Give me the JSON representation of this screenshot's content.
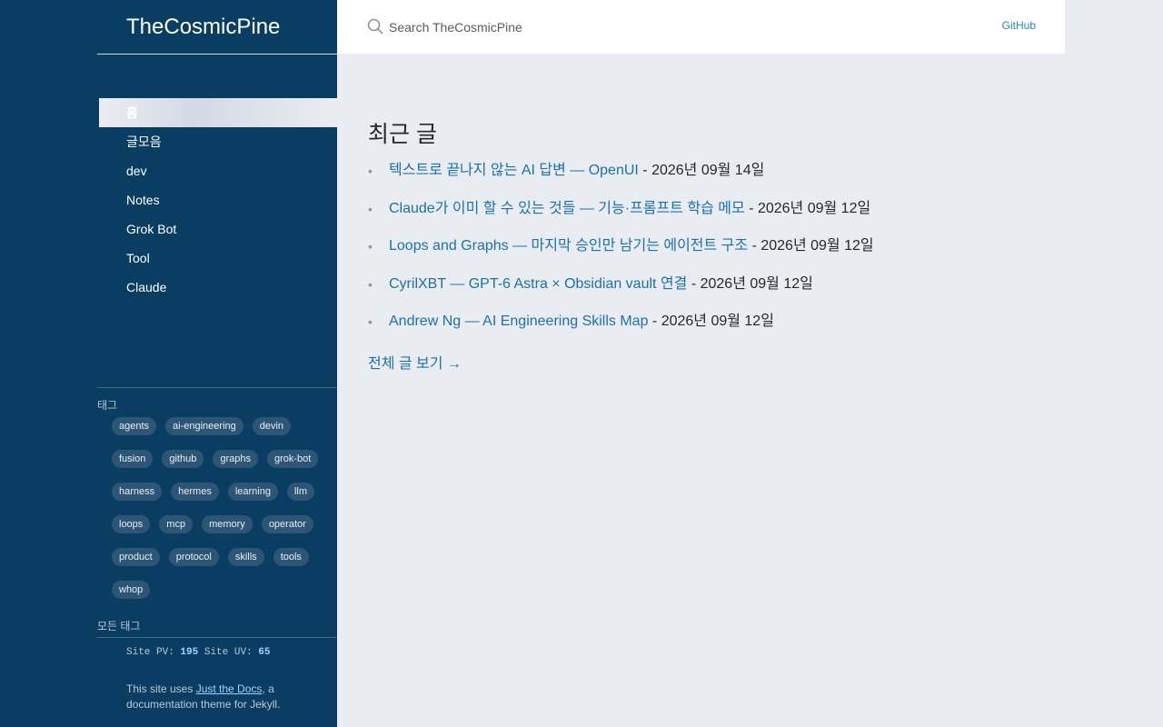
{
  "site": {
    "title": "TheCosmicPine"
  },
  "nav": {
    "items": [
      {
        "label": "홈",
        "active": true
      },
      {
        "label": "글모음",
        "active": false
      },
      {
        "label": "dev",
        "active": false
      },
      {
        "label": "Notes",
        "active": false
      },
      {
        "label": "Grok Bot",
        "active": false
      },
      {
        "label": "Tool",
        "active": false
      },
      {
        "label": "Claude",
        "active": false
      }
    ]
  },
  "tags": {
    "heading": "태그",
    "items": [
      "agents",
      "ai-engineering",
      "devin",
      "fusion",
      "github",
      "graphs",
      "grok-bot",
      "harness",
      "hermes",
      "learning",
      "llm",
      "loops",
      "mcp",
      "memory",
      "operator",
      "product",
      "protocol",
      "skills",
      "tools",
      "whop"
    ],
    "all_label": "모든 태그"
  },
  "stats": {
    "pv_label": "Site PV:",
    "pv_value": "195",
    "uv_label": "Site UV:",
    "uv_value": "65"
  },
  "footer": {
    "prefix": "This site uses ",
    "link_text": "Just the Docs",
    "suffix": ", a documentation theme for Jekyll."
  },
  "search": {
    "placeholder": "Search TheCosmicPine",
    "icon": "search-icon"
  },
  "header": {
    "github_label": "GitHub"
  },
  "main": {
    "title": "최근 글",
    "posts": [
      {
        "title": "텍스트로 끝나지 않는 AI 답변 — OpenUI",
        "date": " - 2026년 09월 14일"
      },
      {
        "title": "Claude가 이미 할 수 있는 것들 — 기능·프롬프트 학습 메모",
        "date": " - 2026년 09월 12일"
      },
      {
        "title": "Loops and Graphs — 마지막 승인만 남기는 에이전트 구조",
        "date": " - 2026년 09월 12일"
      },
      {
        "title": "CyrilXBT — GPT-6 Astra × Obsidian vault 연결",
        "date": " - 2026년 09월 12일"
      },
      {
        "title": "Andrew Ng — AI Engineering Skills Map",
        "date": " - 2026년 09월 12일"
      }
    ],
    "bullet": "•",
    "view_all": "전체 글 보기 →"
  },
  "colors": {
    "sidebar_bg": "#0a3d62",
    "content_bg": "#e9edf1",
    "link": "#1e6fad",
    "tag_bg": "#2d5676"
  }
}
